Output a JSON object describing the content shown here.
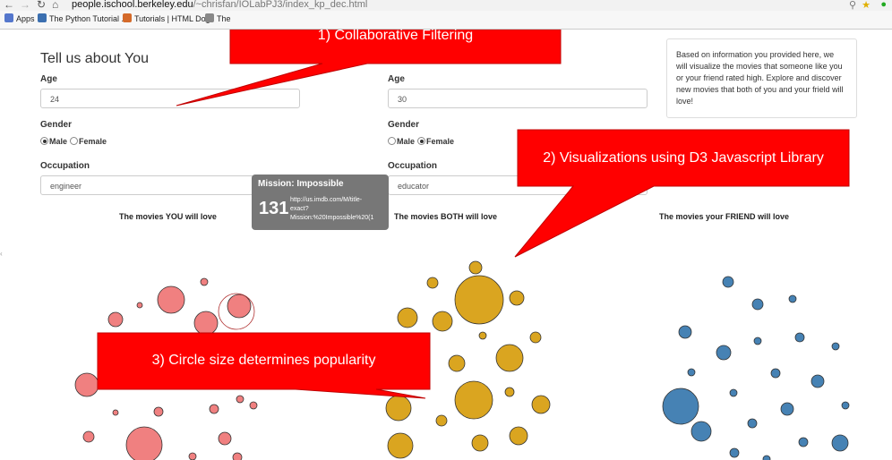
{
  "browser": {
    "url_host": "people.ischool.berkeley.edu",
    "url_path": "/~chrisfan/IOLabPJ3/index_kp_dec.html",
    "bookmarks": [
      {
        "label": "Apps",
        "icon": "apps-grid-icon"
      },
      {
        "label": "The Python Tutorial ...",
        "icon": "python-icon"
      },
      {
        "label": "Tutorials | HTML Dog",
        "icon": "htmldog-icon"
      },
      {
        "label": "The",
        "icon": "bookmark-icon"
      }
    ]
  },
  "form": {
    "you": {
      "title": "Tell us about You",
      "age_label": "Age",
      "age_value": "24",
      "gender_label": "Gender",
      "gender_options": [
        "Male",
        "Female"
      ],
      "gender_selected": "Male",
      "occupation_label": "Occupation",
      "occupation_value": "engineer"
    },
    "friend": {
      "age_label": "Age",
      "age_value": "30",
      "gender_label": "Gender",
      "gender_options": [
        "Male",
        "Female"
      ],
      "gender_selected": "Female",
      "occupation_label": "Occupation",
      "occupation_value": "educator"
    }
  },
  "info_text": "Based on information you provided here, we will visualize the movies that someone like you or your friend rated high. Explore and discover new movies that both of you and your frield will love!",
  "columns": {
    "you": "The movies YOU will love",
    "both": "The movies BOTH will love",
    "friend": "The movies your FRIEND will love"
  },
  "tooltip": {
    "title": "Mission: Impossible",
    "count": "131",
    "url_lines": [
      "http://us.imdb.com/M/title-",
      "exact?",
      "Mission:%20Impossible%20(1"
    ]
  },
  "callouts": {
    "c1": "1) Collaborative Filtering",
    "c2": "2) Visualizations using D3 Javascript Library",
    "c3": "3) Circle size determines popularity"
  },
  "colors": {
    "you": "#f08080",
    "both": "#daa520",
    "friend": "#4682b4",
    "callout": "#ff0000",
    "tooltip": "#777777"
  }
}
